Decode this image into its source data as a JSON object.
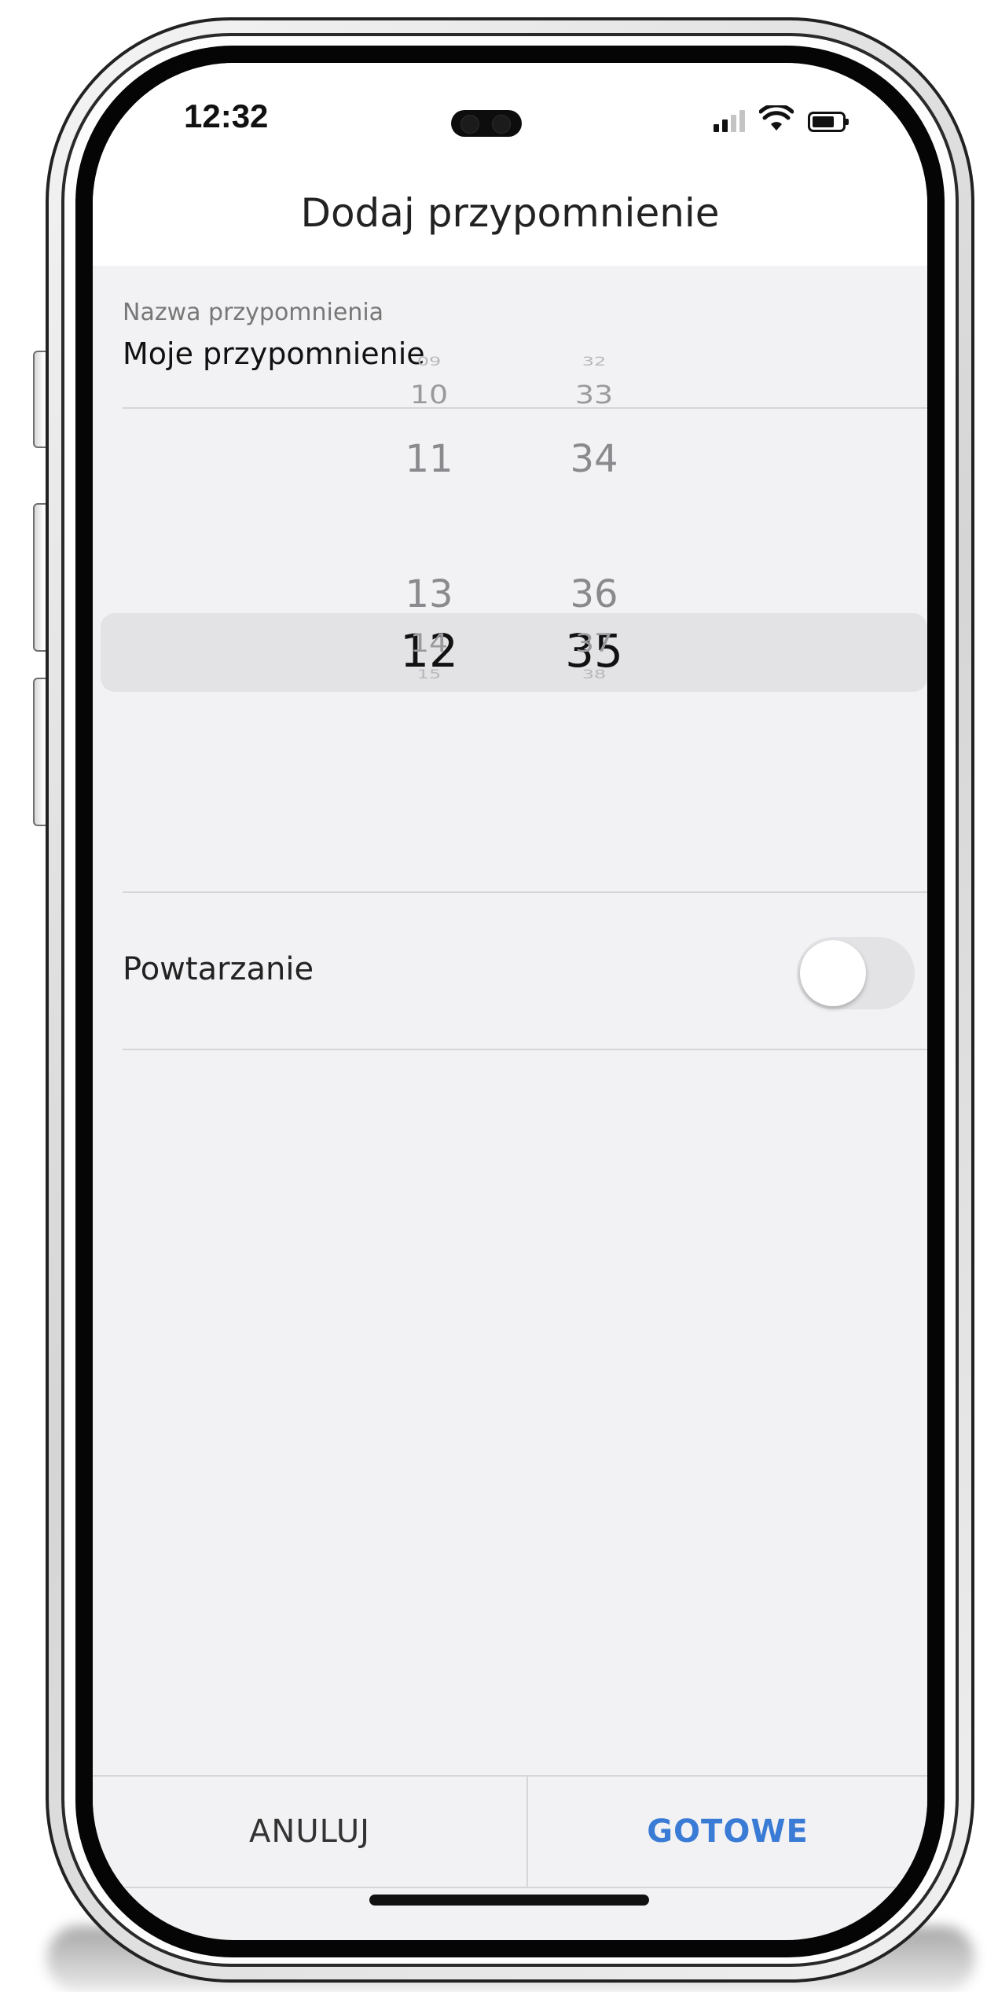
{
  "status_bar": {
    "time": "12:32"
  },
  "header": {
    "title": "Dodaj przypomnienie"
  },
  "form": {
    "name_label": "Nazwa przypomnienia",
    "name_value": "Moje przypomnienie"
  },
  "time_picker": {
    "hours": [
      "09",
      "10",
      "11",
      "12",
      "13",
      "14",
      "15"
    ],
    "minutes": [
      "32",
      "33",
      "34",
      "35",
      "36",
      "37",
      "38"
    ],
    "selected_hour": "12",
    "selected_minute": "35"
  },
  "repeat": {
    "label": "Powtarzanie",
    "enabled": false
  },
  "actions": {
    "cancel_label": "ANULUJ",
    "done_label": "GOTOWE"
  },
  "colors": {
    "accent": "#3a7bd5",
    "background": "#f2f2f4",
    "header": "#ffffff"
  }
}
